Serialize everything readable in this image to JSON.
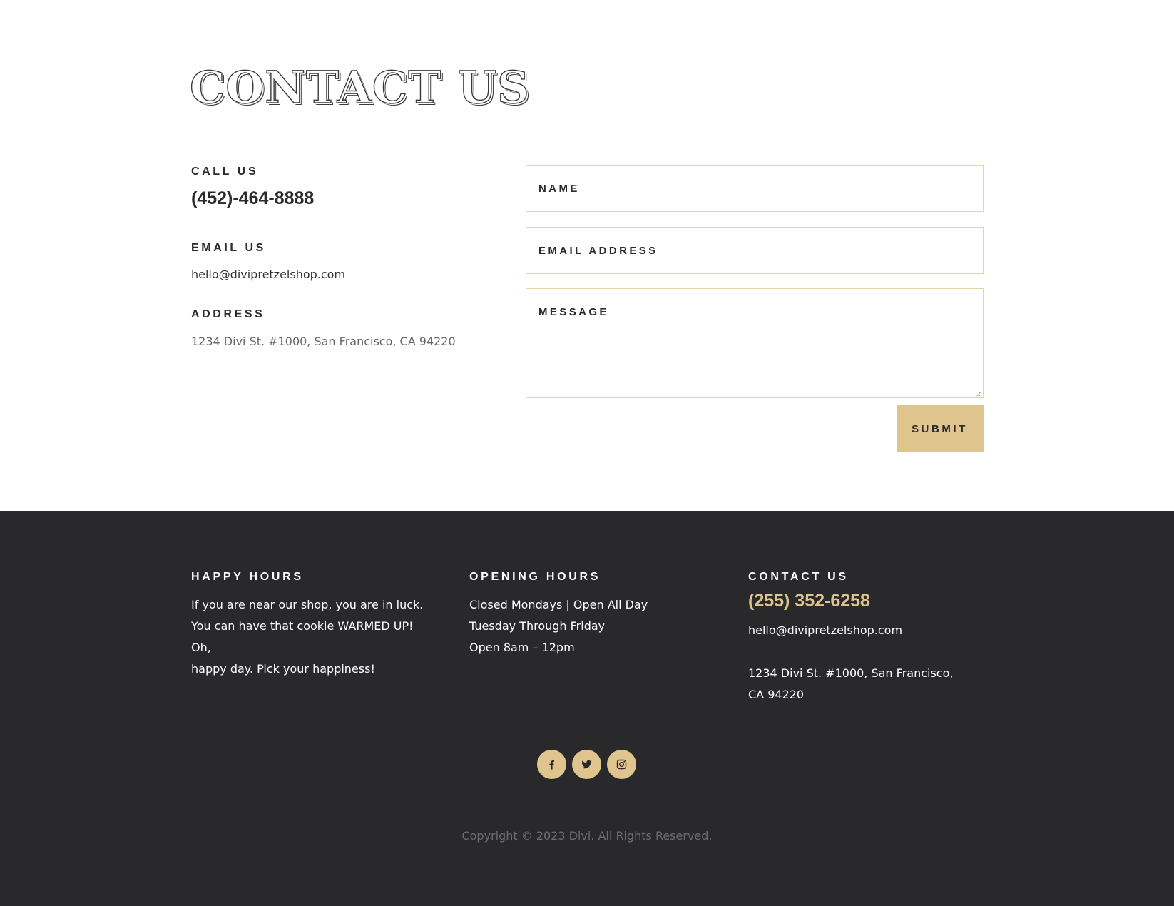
{
  "contact": {
    "title": "CONTACT US",
    "call_label": "CALL US",
    "phone": "(452)-464-8888",
    "email_label": "EMAIL US",
    "email": "hello@divipretzelshop.com",
    "address_label": "ADDRESS",
    "address": "1234 Divi St. #1000, San Francisco, CA 94220"
  },
  "form": {
    "name_placeholder": "NAME",
    "email_placeholder": "EMAIL ADDRESS",
    "message_placeholder": "MESSAGE",
    "submit_label": "SUBMIT"
  },
  "footer": {
    "happy_hours": {
      "heading": "HAPPY HOURS",
      "lines": [
        "If you are near our shop, you are in luck.",
        "You can have that cookie WARMED UP! Oh,",
        "happy day. Pick your happiness!"
      ]
    },
    "opening_hours": {
      "heading": "OPENING HOURS",
      "lines": [
        "Closed Mondays | Open All Day",
        "Tuesday Through Friday",
        "Open 8am – 12pm"
      ]
    },
    "contact": {
      "heading": "CONTACT US",
      "phone": "(255) 352-6258",
      "email": "hello@divipretzelshop.com",
      "address": "1234 Divi St. #1000, San Francisco, CA 94220"
    },
    "social": [
      {
        "icon": "facebook-icon"
      },
      {
        "icon": "twitter-icon"
      },
      {
        "icon": "instagram-icon"
      }
    ],
    "copyright": "Copyright © 2023 Divi. All Rights Reserved."
  },
  "colors": {
    "accent": "#e0c48e",
    "footer_bg": "#29292c",
    "text_dark": "#2b2b2e"
  }
}
